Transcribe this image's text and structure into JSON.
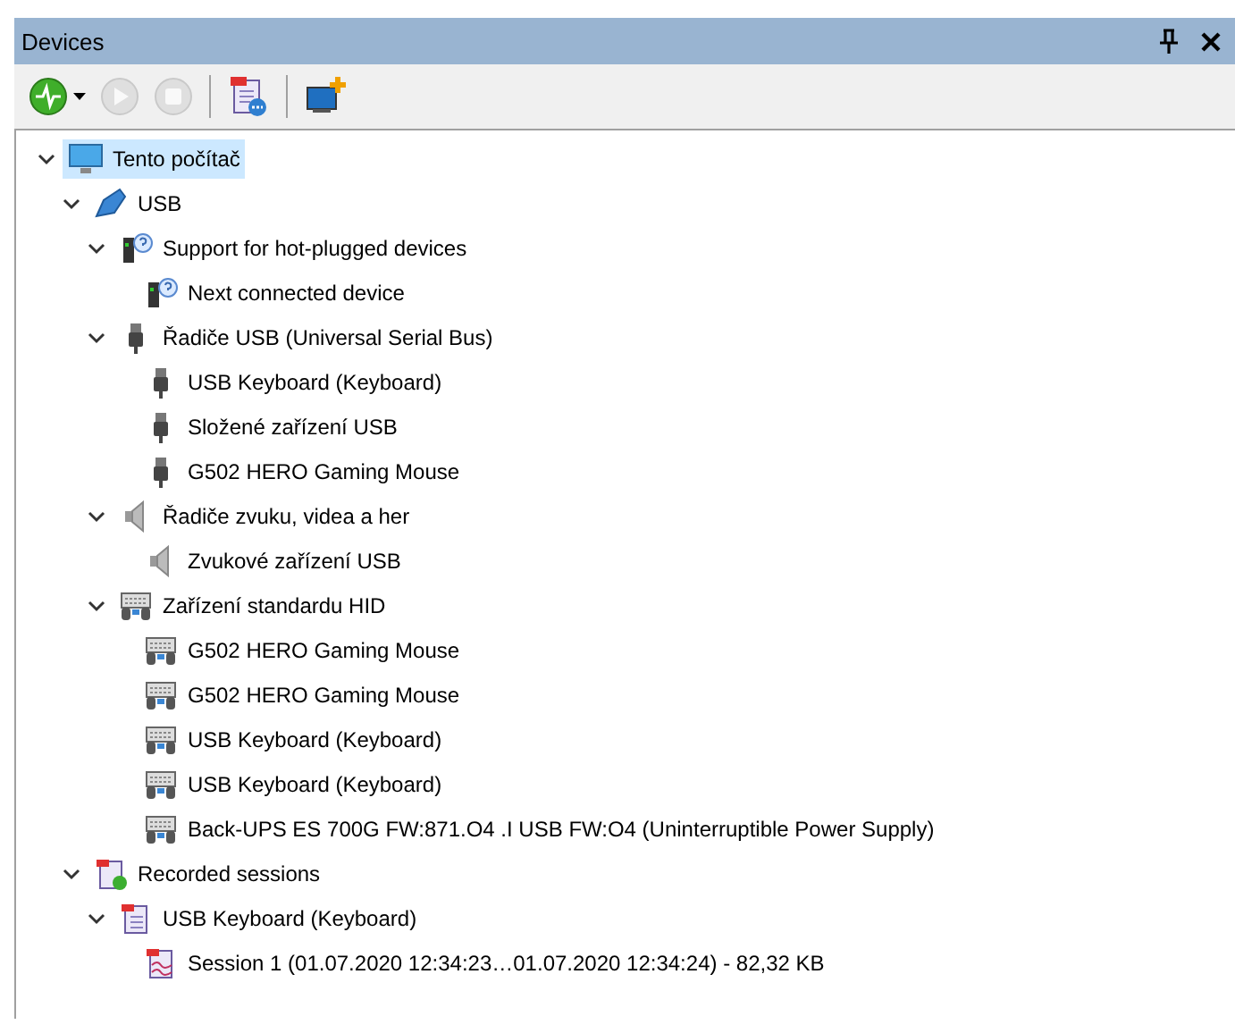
{
  "panel": {
    "title": "Devices"
  },
  "toolbar": [
    {
      "kind": "record",
      "disabled": false,
      "dropdown": true
    },
    {
      "kind": "play",
      "disabled": true,
      "dropdown": false
    },
    {
      "kind": "stop",
      "disabled": true,
      "dropdown": false
    },
    {
      "kind": "separator"
    },
    {
      "kind": "sessions",
      "disabled": false,
      "dropdown": false
    },
    {
      "kind": "separator"
    },
    {
      "kind": "add-device",
      "disabled": false,
      "dropdown": false
    }
  ],
  "tree": [
    {
      "label": "Tento počítač",
      "kind": "computer",
      "selected": true,
      "expanded": true,
      "children": [
        {
          "label": "USB",
          "kind": "usb",
          "selected": false,
          "expanded": true,
          "children": [
            {
              "label": "Support for hot-plugged devices",
              "kind": "hotplug",
              "selected": false,
              "expanded": true,
              "children": [
                {
                  "label": "Next connected device",
                  "kind": "hotplug",
                  "selected": false
                }
              ]
            },
            {
              "label": "Řadiče USB (Universal Serial Bus)",
              "kind": "plug",
              "selected": false,
              "expanded": true,
              "children": [
                {
                  "label": "USB Keyboard (Keyboard)",
                  "kind": "plug",
                  "selected": false
                },
                {
                  "label": "Složené zařízení USB",
                  "kind": "plug",
                  "selected": false
                },
                {
                  "label": "G502 HERO Gaming Mouse",
                  "kind": "plug",
                  "selected": false
                }
              ]
            },
            {
              "label": "Řadiče zvuku, videa a her",
              "kind": "audio",
              "selected": false,
              "expanded": true,
              "children": [
                {
                  "label": "Zvukové zařízení USB",
                  "kind": "audio",
                  "selected": false
                }
              ]
            },
            {
              "label": "Zařízení standardu HID",
              "kind": "hid",
              "selected": false,
              "expanded": true,
              "children": [
                {
                  "label": "G502 HERO Gaming Mouse",
                  "kind": "hid",
                  "selected": false
                },
                {
                  "label": "G502 HERO Gaming Mouse",
                  "kind": "hid",
                  "selected": false
                },
                {
                  "label": "USB Keyboard (Keyboard)",
                  "kind": "hid",
                  "selected": false
                },
                {
                  "label": "USB Keyboard (Keyboard)",
                  "kind": "hid",
                  "selected": false
                },
                {
                  "label": "Back-UPS ES 700G FW:871.O4 .I USB FW:O4 (Uninterruptible Power Supply)",
                  "kind": "hid",
                  "selected": false
                }
              ]
            }
          ]
        },
        {
          "label": "Recorded sessions",
          "kind": "sessions",
          "selected": false,
          "expanded": true,
          "children": [
            {
              "label": "USB Keyboard (Keyboard)",
              "kind": "log",
              "selected": false,
              "expanded": true,
              "children": [
                {
                  "label": "Session 1 (01.07.2020 12:34:23…01.07.2020 12:34:24) - 82,32 KB",
                  "kind": "session",
                  "selected": false
                }
              ]
            }
          ]
        }
      ]
    }
  ]
}
